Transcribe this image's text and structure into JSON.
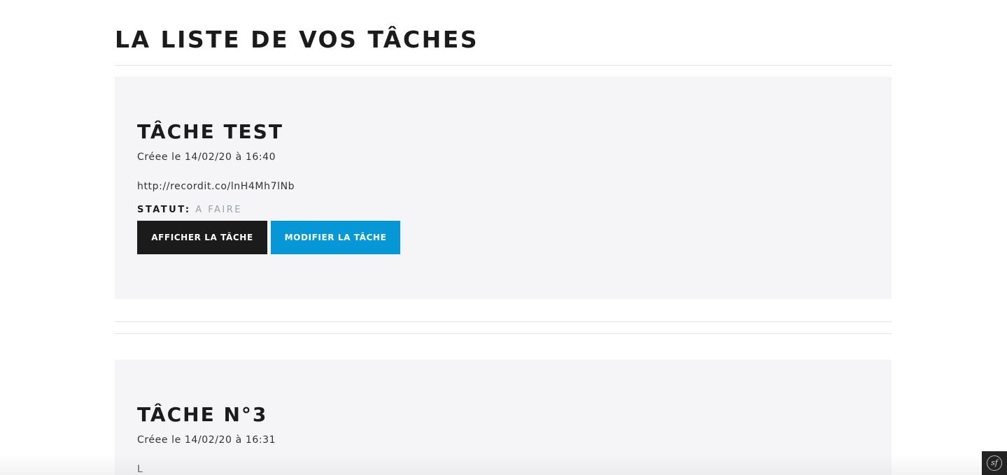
{
  "page": {
    "title": "LA LISTE DE VOS TÂCHES"
  },
  "tasks": [
    {
      "title": "TÂCHE TEST",
      "created": "Créee le 14/02/20 à 16:40",
      "description": "http://recordit.co/lnH4Mh7lNb",
      "status_label": "STATUT:",
      "status_value": "A FAIRE",
      "show_button": "AFFICHER LA TÂCHE",
      "edit_button": "MODIFIER LA TÂCHE"
    },
    {
      "title": "TÂCHE N°3",
      "created": "Créee le 14/02/20 à 16:31",
      "description": "L"
    }
  ],
  "toolbar": {
    "logo_text": "sf",
    "icon": "symfony-logo-icon"
  },
  "colors": {
    "card_background": "#f5f5f7",
    "button_dark": "#1b1b1b",
    "button_blue": "#0698d6",
    "status_value": "#9aa0a6",
    "text": "#1b1b1b"
  }
}
